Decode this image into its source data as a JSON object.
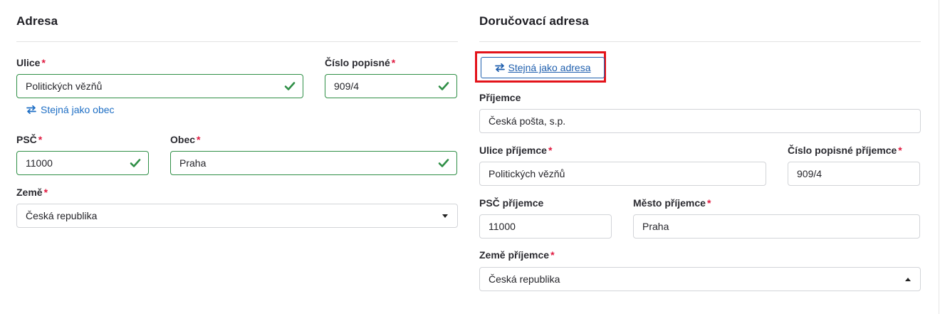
{
  "address": {
    "title": "Adresa",
    "street": {
      "label": "Ulice",
      "value": "Politických vězňů"
    },
    "house_number": {
      "label": "Číslo popisné",
      "value": "909/4"
    },
    "same_as_city_link": "Stejná jako obec",
    "zip": {
      "label": "PSČ",
      "value": "11000"
    },
    "city": {
      "label": "Obec",
      "value": "Praha"
    },
    "country": {
      "label": "Země",
      "value": "Česká republika"
    },
    "required_mark": "*"
  },
  "delivery": {
    "title": "Doručovací adresa",
    "same_as_address_button": "Stejná jako adresa",
    "recipient": {
      "label": "Příjemce",
      "value": "Česká pošta, s.p."
    },
    "street": {
      "label": "Ulice příjemce",
      "value": "Politických vězňů"
    },
    "house_number": {
      "label": "Číslo popisné příjemce",
      "value": "909/4"
    },
    "zip": {
      "label": "PSČ příjemce",
      "value": "11000"
    },
    "city": {
      "label": "Město příjemce",
      "value": "Praha"
    },
    "country": {
      "label": "Země příjemce",
      "value": "Česká republika"
    },
    "required_mark": "*"
  },
  "colors": {
    "valid_border": "#2f8f46",
    "link": "#1f6fc5",
    "required": "#e0193f",
    "highlight": "#e3131a"
  }
}
